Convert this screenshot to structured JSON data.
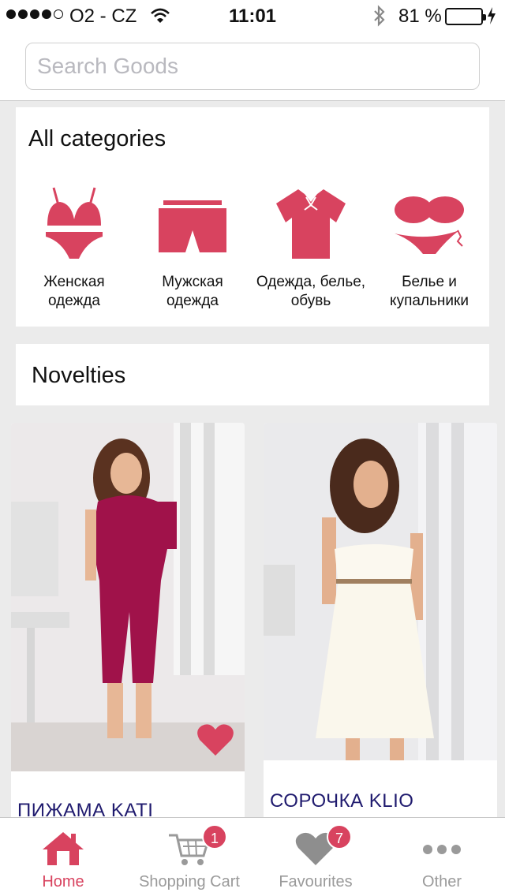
{
  "status_bar": {
    "carrier": "O2 - CZ",
    "time": "11:01",
    "battery_percent": "81 %",
    "battery_level": 0.81,
    "signal_bars": 4
  },
  "search": {
    "placeholder": "Search Goods",
    "icon": "search-field"
  },
  "categories": {
    "heading": "All categories",
    "items": [
      {
        "label": "Женская одежда",
        "icon": "bikini-icon"
      },
      {
        "label": "Мужская одежда",
        "icon": "shorts-icon"
      },
      {
        "label": "Одежда, белье, обувь",
        "icon": "blouse-icon"
      },
      {
        "label": "Белье и купальники",
        "icon": "bra-panties-icon"
      }
    ]
  },
  "novelties": {
    "heading": "Novelties",
    "products": [
      {
        "name": "ПИЖАМА  KATI",
        "favorited": true
      },
      {
        "name": "СОРОЧКА KLIO",
        "favorited": false
      }
    ]
  },
  "tab_bar": {
    "tabs": [
      {
        "label": "Home",
        "icon": "home-icon",
        "active": true
      },
      {
        "label": "Shopping Cart",
        "icon": "cart-icon",
        "badge": "1"
      },
      {
        "label": "Favourites",
        "icon": "heart-icon",
        "badge": "7"
      },
      {
        "label": "Other",
        "icon": "more-icon"
      }
    ]
  },
  "colors": {
    "accent": "#d8435f",
    "background": "#ebebeb",
    "product_title": "#1f1a6e",
    "battery": "#4cd964"
  }
}
